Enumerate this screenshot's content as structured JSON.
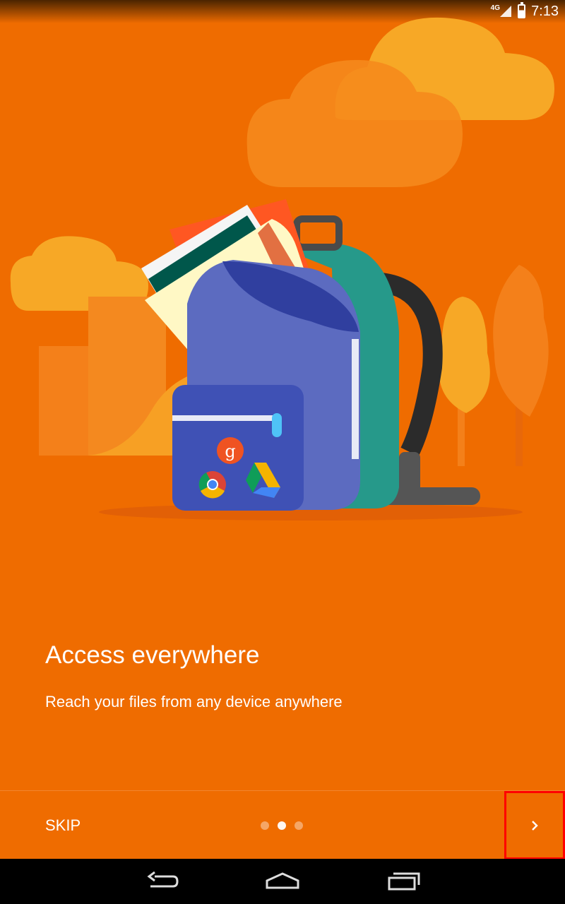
{
  "status_bar": {
    "network": "4G",
    "time": "7:13"
  },
  "content": {
    "title": "Access everywhere",
    "subtitle": "Reach your files from any device anywhere"
  },
  "footer": {
    "skip_label": "SKIP",
    "page_indicator": {
      "total": 3,
      "active_index": 1
    },
    "next_icon": "chevron-right-icon"
  },
  "nav_bar": {
    "icons": [
      "back-icon",
      "home-icon",
      "recents-icon"
    ]
  },
  "colors": {
    "background": "#ef6c00",
    "backpack": "#5c6bc0",
    "backpack_side": "#26998a"
  }
}
